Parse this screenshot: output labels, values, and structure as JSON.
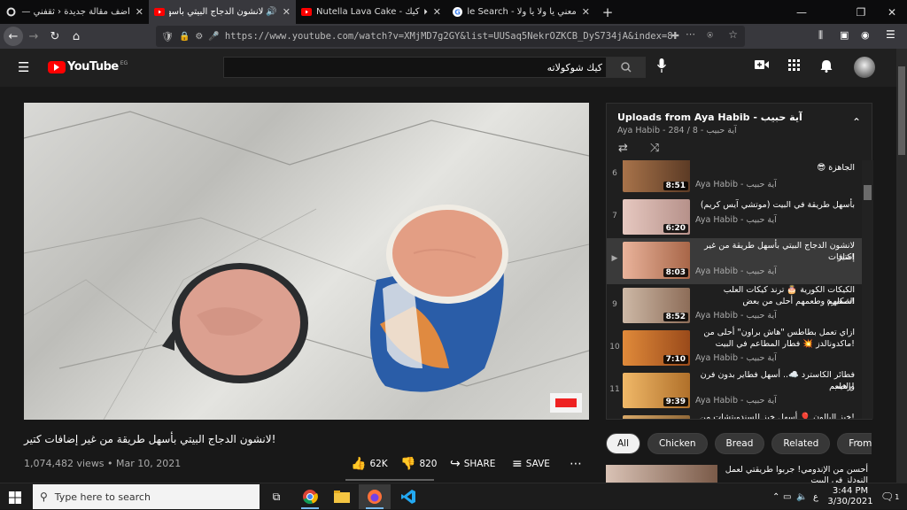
{
  "browser": {
    "tabs": [
      {
        "title": "أضف مقالة جديدة ‹ ثقفني — ور",
        "icon": "wordpress-icon"
      },
      {
        "title": "لانشون الدجاج البيتي بأسهل",
        "icon": "youtube-icon",
        "active": true
      },
      {
        "title": "Nutella Lava Cake - لافا كيك",
        "icon": "youtube-icon"
      },
      {
        "title": "معني يا ولا يا ولا - Google Search",
        "icon": "google-icon"
      }
    ],
    "url": "https://www.youtube.com/watch?v=XMjMD7g2GY&list=UUSaq5NekrOZKCB_DyS734jA&index=8"
  },
  "youtube": {
    "region": "EG",
    "logo_text": "YouTube",
    "search_value": "كيك شوكولاته"
  },
  "video": {
    "title": "!لانشون الدجاج البيتي بأسهل طريقة من غير إضافات كتير",
    "views": "1,074,482 views",
    "date": "Mar 10, 2021",
    "likes": "62K",
    "dislikes": "820",
    "share": "SHARE",
    "save": "SAVE"
  },
  "playlist": {
    "title": "Uploads from Aya Habib - آية حبيب",
    "subtitle": "Aya Habib - آية حبيب - 8 / 284",
    "items": [
      {
        "index": "6",
        "title": "الجاهزة 😎",
        "title2": "",
        "channel": "Aya Habib - آية حبيب",
        "duration": "8:51",
        "color": "#8a5a3a"
      },
      {
        "index": "7",
        "title": "بأسهل طريقة في البيت (موتشي آيس كريم)",
        "title2": "",
        "channel": "Aya Habib - آية حبيب",
        "duration": "6:20",
        "color": "#d8b7b0"
      },
      {
        "index": "▶",
        "title": "لانشون الدجاج البيتي بأسهل طريقة من غير إضافات",
        "title2": "!كتير",
        "channel": "Aya Habib - آية حبيب",
        "duration": "8:03",
        "color": "#d79a7a"
      },
      {
        "index": "9",
        "title": "الكيكات الكورية 🎂 ترند كيكات العلب الصغيرة",
        "title2": "!شكلهم وطعمهم أحلى من بعض",
        "channel": "Aya Habib - آية حبيب",
        "duration": "8:52",
        "color": "#b9a08c"
      },
      {
        "index": "10",
        "title": "ازاي تعمل بطاطس \"هاش براون\" أحلى من",
        "title2": "!ماكدونالدز 💥 فطار المطاعم في البيت",
        "channel": "Aya Habib - آية حبيب",
        "duration": "7:10",
        "color": "#c97b3a"
      },
      {
        "index": "11",
        "title": "فطائر الكاسترد ☁️.. أسهل فطاير بدون فرن والطعم",
        "title2": "!رهيب",
        "channel": "Aya Habib - آية حبيب",
        "duration": "9:39",
        "color": "#e0a55a"
      },
      {
        "index": "",
        "title": "!خبز البالون 🎈 أسهل خبز للسندويتشات من غير فرن",
        "title2": "",
        "channel": "",
        "duration": "",
        "color": "#c79a5c"
      }
    ]
  },
  "chips": [
    "All",
    "Chicken",
    "Bread",
    "Related",
    "From Aya H"
  ],
  "recommendation": {
    "title": "أحسن من الإندومي! جربوا طريقتي لعمل",
    "title2": "النودلز في البيت"
  },
  "taskbar": {
    "search_placeholder": "Type here to search",
    "lang": "ع",
    "time": "3:44 PM",
    "date": "3/30/2021",
    "notifications": "1"
  }
}
